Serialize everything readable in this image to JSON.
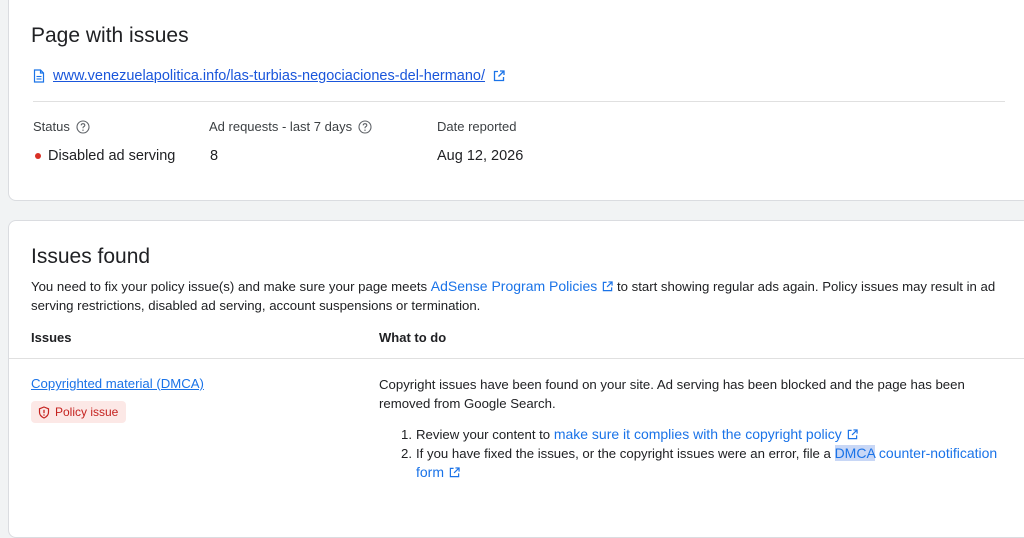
{
  "page_card": {
    "title": "Page with issues",
    "url": "www.venezuelapolitica.info/las-turbias-negociaciones-del-hermano/",
    "status": {
      "label": "Status",
      "value": "Disabled ad serving",
      "dot_color": "#d93025"
    },
    "ad_requests": {
      "label": "Ad requests - last 7 days",
      "value": "8"
    },
    "date_reported": {
      "label": "Date reported",
      "value": "Aug 12, 2026"
    }
  },
  "issues_card": {
    "title": "Issues found",
    "intro": {
      "before": "You need to fix your policy issue(s) and make sure your page meets ",
      "link": "AdSense Program Policies",
      "after": " to start showing regular ads again. Policy issues may result in ad serving restrictions, disabled ad serving, account suspensions or termination."
    },
    "columns": {
      "issues": "Issues",
      "what_to_do": "What to do"
    },
    "rows": [
      {
        "name": "Copyrighted material (DMCA)",
        "badge": "Policy issue",
        "description": "Copyright issues have been found on your site. Ad serving has been blocked and the page has been removed from Google Search.",
        "steps": [
          {
            "number": "1.",
            "before": "Review your content to ",
            "link": "make sure it complies with the copyright policy"
          },
          {
            "number": "2.",
            "before": "If you have fixed the issues, or the copyright issues were an error, file a ",
            "link_highlight": "DMCA",
            "link": " counter-notification form"
          }
        ]
      }
    ]
  },
  "colors": {
    "link": "#1a73e8",
    "error": "#d93025",
    "badge_bg": "#fce8e6",
    "badge_text": "#c5221f"
  }
}
